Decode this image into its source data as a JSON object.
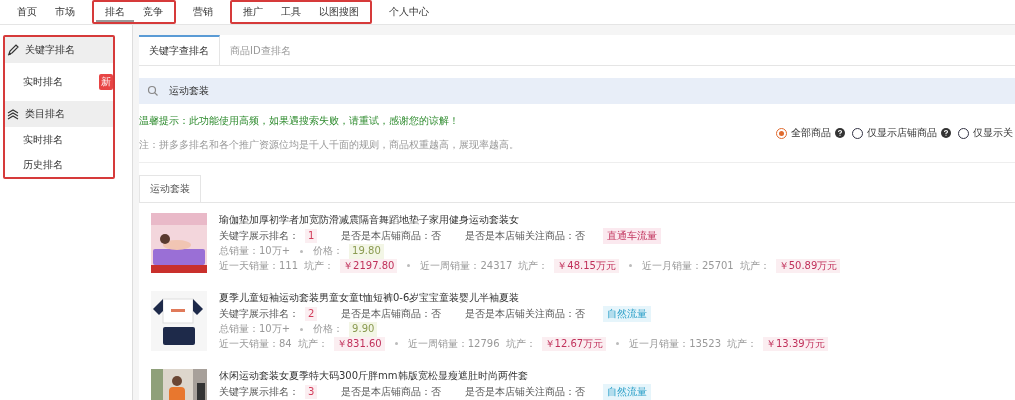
{
  "nav": [
    {
      "outlined": false,
      "items": [
        {
          "label": "首页",
          "selected": false
        },
        {
          "label": "市场",
          "selected": false
        }
      ]
    },
    {
      "outlined": true,
      "items": [
        {
          "label": "排名",
          "selected": true
        },
        {
          "label": "竞争",
          "selected": false
        }
      ]
    },
    {
      "outlined": false,
      "items": [
        {
          "label": "营销",
          "selected": false
        }
      ]
    },
    {
      "outlined": true,
      "items": [
        {
          "label": "推广",
          "selected": false
        },
        {
          "label": "工具",
          "selected": false
        },
        {
          "label": "以图搜图",
          "selected": false
        }
      ]
    },
    {
      "outlined": false,
      "items": [
        {
          "label": "个人中心",
          "selected": false
        }
      ]
    }
  ],
  "sidebar": {
    "outlined": true,
    "sections": [
      {
        "title": "关键字排名",
        "items": [
          {
            "label": "实时排名",
            "badge": "新"
          }
        ]
      },
      {
        "title": "类目排名",
        "items": [
          {
            "label": "实时排名"
          },
          {
            "label": "历史排名"
          }
        ]
      }
    ]
  },
  "tabs": [
    {
      "label": "关键字查排名",
      "selected": true
    },
    {
      "label": "商品ID查排名",
      "selected": false
    }
  ],
  "search": {
    "value": "运动套装"
  },
  "tip": "温馨提示：此功能使用高频，如果遇搜索失败，请重试，感谢您的谅解！",
  "note": "注：拼多多排名和各个推广资源位均是千人千面的规则，商品权重越高，展现率越高。",
  "filters": [
    {
      "label": "全部商品",
      "selected": true,
      "help": true
    },
    {
      "label": "仅显示店铺商品",
      "selected": false,
      "help": true
    },
    {
      "label": "仅显示关",
      "selected": false,
      "help": false
    }
  ],
  "result_tab": "运动套装",
  "products": [
    {
      "title": "瑜伽垫加厚初学者加宽防滑减震隔音舞蹈地垫子家用健身运动套装女",
      "rank": {
        "label": "关键字展示排名：",
        "value": "1"
      },
      "own": {
        "label": "是否是本店铺商品：",
        "value": "否"
      },
      "followed": {
        "label": "是否是本店铺关注商品：",
        "value": "否"
      },
      "tag": {
        "label": "直通车流量",
        "kind": "paid"
      },
      "sales": {
        "label": "总销量：10万+",
        "price_label": "价格：",
        "price": "19.80"
      },
      "periods": [
        {
          "label": "近一天销量：111",
          "output_label": "坑产：",
          "output": "￥2197.80"
        },
        {
          "label": "近一周销量：24317",
          "output_label": "坑产：",
          "output": "￥48.15万元"
        },
        {
          "label": "近一月销量：25701",
          "output_label": "坑产：",
          "output": "￥50.89万元"
        }
      ]
    },
    {
      "title": "夏季儿童短袖运动套装男童女童t恤短裤0-6岁宝宝童装婴儿半袖夏装",
      "rank": {
        "label": "关键字展示排名：",
        "value": "2"
      },
      "own": {
        "label": "是否是本店铺商品：",
        "value": "否"
      },
      "followed": {
        "label": "是否是本店铺关注商品：",
        "value": "否"
      },
      "tag": {
        "label": "自然流量",
        "kind": "natural"
      },
      "sales": {
        "label": "总销量：10万+",
        "price_label": "价格：",
        "price": "9.90"
      },
      "periods": [
        {
          "label": "近一天销量：84",
          "output_label": "坑产：",
          "output": "￥831.60"
        },
        {
          "label": "近一周销量：12796",
          "output_label": "坑产：",
          "output": "￥12.67万元"
        },
        {
          "label": "近一月销量：13523",
          "output_label": "坑产：",
          "output": "￥13.39万元"
        }
      ]
    },
    {
      "title": "休闲运动套装女夏季特大码300斤胖mm韩版宽松显瘦遮肚时尚两件套",
      "rank": {
        "label": "关键字展示排名：",
        "value": "3"
      },
      "own": {
        "label": "是否是本店铺商品：",
        "value": "否"
      },
      "followed": {
        "label": "是否是本店铺关注商品：",
        "value": "否"
      },
      "tag": {
        "label": "自然流量",
        "kind": "natural"
      }
    }
  ]
}
